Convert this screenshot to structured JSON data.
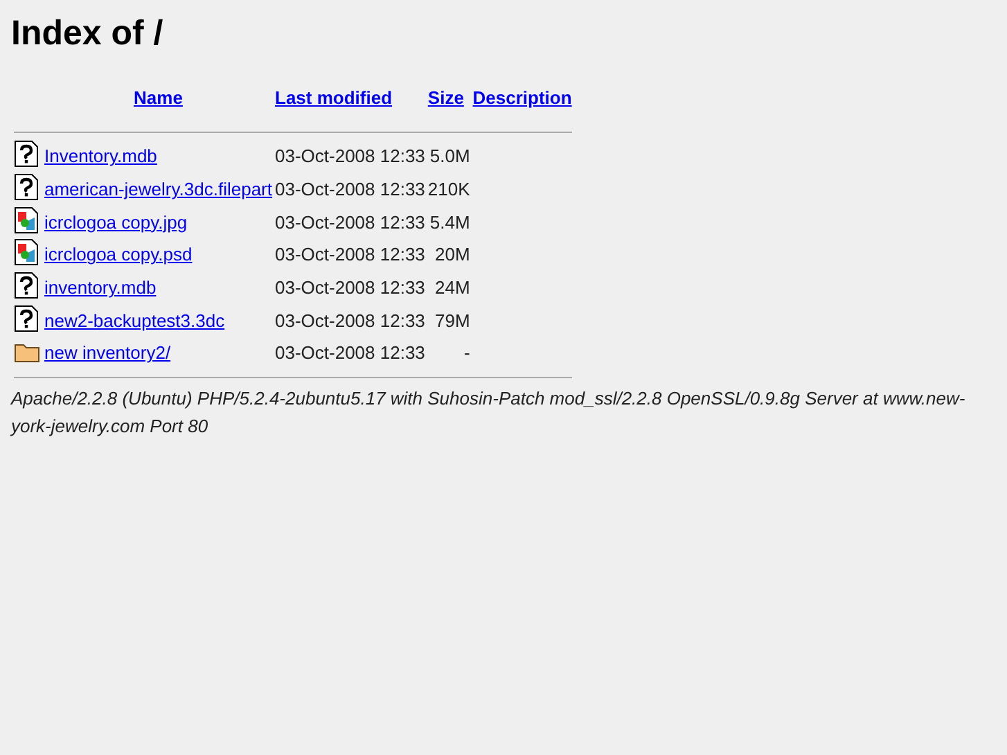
{
  "title": "Index of /",
  "columns": [
    "Name",
    "Last modified",
    "Size",
    "Description"
  ],
  "rows": [
    {
      "kind": "unknown",
      "name": "Inventory.mdb",
      "modified": "03-Oct-2008 12:33",
      "size": "5.0M"
    },
    {
      "kind": "unknown",
      "name": "american-jewelry.3dc.filepart",
      "modified": "03-Oct-2008 12:33",
      "size": "210K"
    },
    {
      "kind": "image",
      "name": "icrclogoa copy.jpg",
      "modified": "03-Oct-2008 12:33",
      "size": "5.4M"
    },
    {
      "kind": "image",
      "name": "icrclogoa copy.psd",
      "modified": "03-Oct-2008 12:33",
      "size": "20M"
    },
    {
      "kind": "unknown",
      "name": "inventory.mdb",
      "modified": "03-Oct-2008 12:33",
      "size": "24M"
    },
    {
      "kind": "unknown",
      "name": "new2-backuptest3.3dc",
      "modified": "03-Oct-2008 12:33",
      "size": "79M"
    },
    {
      "kind": "folder",
      "name": "new inventory2/",
      "modified": "03-Oct-2008 12:33",
      "size": "-"
    }
  ],
  "address": "Apache/2.2.8 (Ubuntu) PHP/5.2.4-2ubuntu5.17 with Suhosin-Patch mod_ssl/2.2.8 OpenSSL/0.9.8g Server at www.new-york-jewelry.com Port 80"
}
